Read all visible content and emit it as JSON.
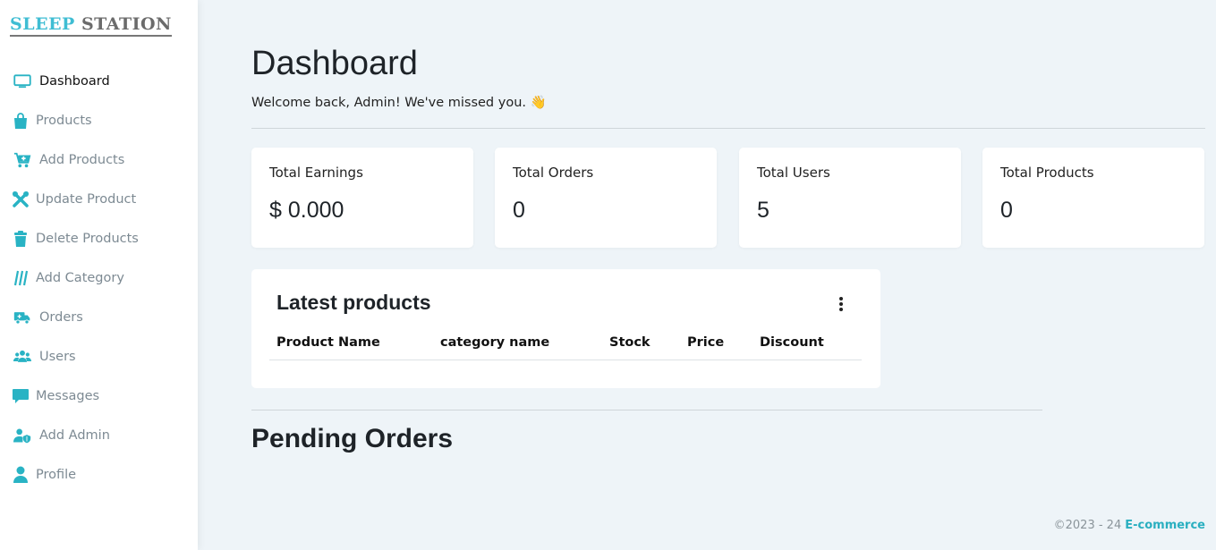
{
  "brand": {
    "part1": "SLEEP ",
    "part2": "STATION"
  },
  "sidebar": {
    "items": [
      {
        "label": "Dashboard",
        "icon": "monitor-icon",
        "active": true
      },
      {
        "label": "Products",
        "icon": "shopping-bag-icon"
      },
      {
        "label": "Add Products",
        "icon": "cart-plus-icon"
      },
      {
        "label": "Update Product",
        "icon": "tools-icon"
      },
      {
        "label": "Delete Products",
        "icon": "trash-icon"
      },
      {
        "label": "Add Category",
        "icon": "category-lines-icon"
      },
      {
        "label": "Orders",
        "icon": "truck-icon"
      },
      {
        "label": "Users",
        "icon": "users-icon"
      },
      {
        "label": "Messages",
        "icon": "message-icon"
      },
      {
        "label": "Add Admin",
        "icon": "user-shield-icon"
      },
      {
        "label": "Profile",
        "icon": "user-icon"
      }
    ],
    "icon_color": "#29b3c4"
  },
  "header": {
    "title": "Dashboard",
    "welcome": "Welcome back, Admin! We've missed you. 👋"
  },
  "stats": [
    {
      "label": "Total Earnings",
      "value": "$ 0.000"
    },
    {
      "label": "Total Orders",
      "value": "0"
    },
    {
      "label": "Total Users",
      "value": "5"
    },
    {
      "label": "Total Products",
      "value": "0"
    }
  ],
  "latest_products": {
    "title": "Latest products",
    "columns": [
      "Product Name",
      "category name",
      "Stock",
      "Price",
      "Discount"
    ],
    "rows": []
  },
  "pending_orders": {
    "title": "Pending Orders"
  },
  "footer": {
    "copyright": "©2023 - 24",
    "link": "E-commerce"
  },
  "colors": {
    "accent": "#29b3c4",
    "background": "#eef4f8"
  }
}
